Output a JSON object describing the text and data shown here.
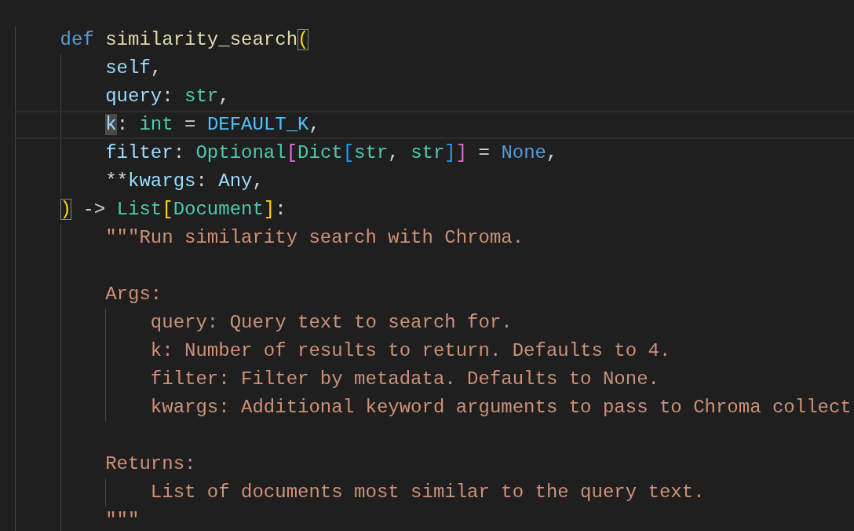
{
  "editor": {
    "lines": [
      {
        "kind": "code",
        "current": false,
        "tokens": [
          {
            "text": "def ",
            "kind": "keyword"
          },
          {
            "text": "similarity_search",
            "kind": "function"
          },
          {
            "text": "(",
            "kind": "matched-bracket"
          }
        ],
        "children": [
          {
            "kind": "code",
            "current": false,
            "tokens": [
              {
                "text": "self",
                "kind": "param"
              },
              {
                "text": ",",
                "kind": "punct"
              }
            ]
          },
          {
            "kind": "code",
            "current": false,
            "tokens": [
              {
                "text": "query",
                "kind": "param"
              },
              {
                "text": ": ",
                "kind": "punct"
              },
              {
                "text": "str",
                "kind": "type"
              },
              {
                "text": ",",
                "kind": "punct"
              }
            ]
          },
          {
            "kind": "code",
            "current": true,
            "tokens": [
              {
                "text": "k",
                "kind": "param"
              },
              {
                "text": ": ",
                "kind": "punct"
              },
              {
                "text": "int",
                "kind": "type"
              },
              {
                "text": " = ",
                "kind": "punct"
              },
              {
                "text": "DEFAULT_K",
                "kind": "constant"
              },
              {
                "text": ",",
                "kind": "punct"
              }
            ]
          },
          {
            "kind": "code",
            "current": false,
            "tokens": [
              {
                "text": "filter",
                "kind": "param"
              },
              {
                "text": ": ",
                "kind": "punct"
              },
              {
                "text": "Optional",
                "kind": "type"
              },
              {
                "text": "[",
                "kind": "bracket2"
              },
              {
                "text": "Dict",
                "kind": "type"
              },
              {
                "text": "[",
                "kind": "bracket3"
              },
              {
                "text": "str",
                "kind": "type"
              },
              {
                "text": ", ",
                "kind": "punct"
              },
              {
                "text": "str",
                "kind": "type"
              },
              {
                "text": "]",
                "kind": "bracket3"
              },
              {
                "text": "]",
                "kind": "bracket2"
              },
              {
                "text": " = ",
                "kind": "punct"
              },
              {
                "text": "None",
                "kind": "keyword"
              },
              {
                "text": ",",
                "kind": "punct"
              }
            ]
          },
          {
            "kind": "code",
            "current": false,
            "tokens": [
              {
                "text": "**",
                "kind": "punct"
              },
              {
                "text": "kwargs",
                "kind": "param"
              },
              {
                "text": ": ",
                "kind": "punct"
              },
              {
                "text": "Any",
                "kind": "param"
              },
              {
                "text": ",",
                "kind": "punct"
              }
            ]
          }
        ]
      },
      {
        "kind": "code",
        "current": false,
        "tokens": [
          {
            "text": ")",
            "kind": "matched-bracket"
          },
          {
            "text": " -> ",
            "kind": "punct"
          },
          {
            "text": "List",
            "kind": "type"
          },
          {
            "text": "[",
            "kind": "bracket1"
          },
          {
            "text": "Document",
            "kind": "type"
          },
          {
            "text": "]",
            "kind": "bracket1"
          },
          {
            "text": ":",
            "kind": "punct"
          }
        ],
        "children": [
          {
            "kind": "code",
            "current": false,
            "tokens": [
              {
                "text": "\"\"\"Run similarity search with Chroma.",
                "kind": "string"
              }
            ]
          },
          {
            "kind": "blank"
          },
          {
            "kind": "code",
            "current": false,
            "tokens": [
              {
                "text": "Args:",
                "kind": "string"
              }
            ],
            "children": [
              {
                "kind": "code",
                "current": false,
                "tokens": [
                  {
                    "text": "query: Query text to search for.",
                    "kind": "string"
                  }
                ]
              },
              {
                "kind": "code",
                "current": false,
                "tokens": [
                  {
                    "text": "k: Number of results to return. Defaults to 4.",
                    "kind": "string"
                  }
                ]
              },
              {
                "kind": "code",
                "current": false,
                "tokens": [
                  {
                    "text": "filter: Filter by metadata. Defaults to None.",
                    "kind": "string"
                  }
                ]
              },
              {
                "kind": "code",
                "current": false,
                "tokens": [
                  {
                    "text": "kwargs: Additional keyword arguments to pass to Chroma collect",
                    "kind": "string"
                  }
                ]
              }
            ]
          },
          {
            "kind": "blank"
          },
          {
            "kind": "code",
            "current": false,
            "tokens": [
              {
                "text": "Returns:",
                "kind": "string"
              }
            ],
            "children": [
              {
                "kind": "code",
                "current": false,
                "tokens": [
                  {
                    "text": "List of documents most similar to the query text.",
                    "kind": "string"
                  }
                ]
              }
            ]
          },
          {
            "kind": "code",
            "current": false,
            "tokens": [
              {
                "text": "\"\"\"",
                "kind": "string"
              }
            ]
          }
        ]
      }
    ]
  }
}
